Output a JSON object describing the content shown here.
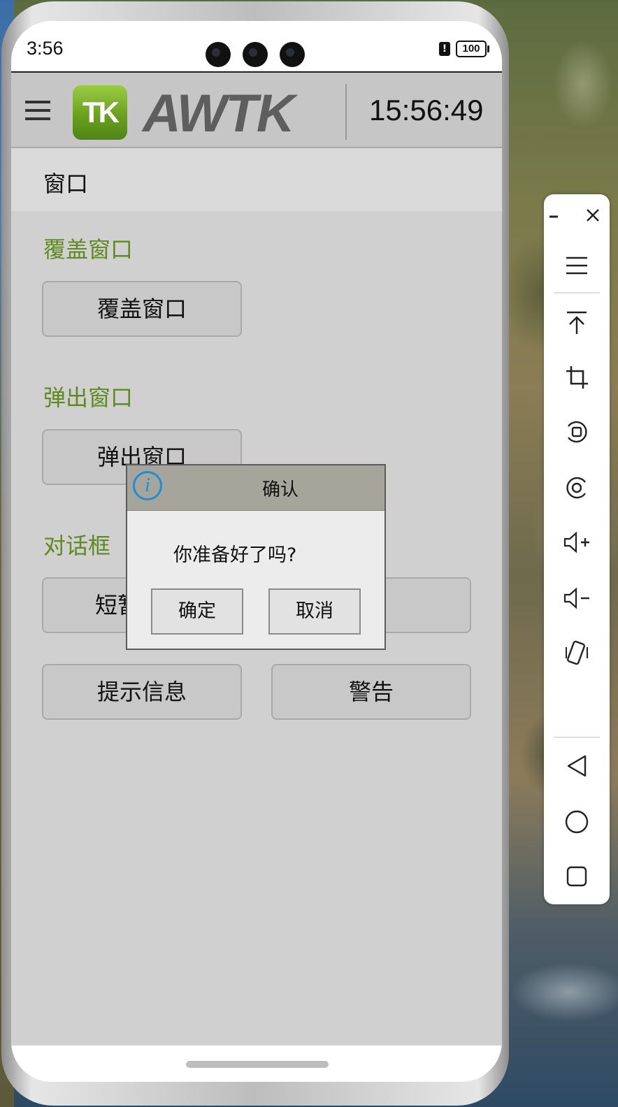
{
  "status_bar": {
    "time": "3:56",
    "alert": "!",
    "battery": "100"
  },
  "header": {
    "logo_badge": "TK",
    "logo_text": "AWTK",
    "clock": "15:56:49"
  },
  "page": {
    "title": "窗口"
  },
  "sections": {
    "overlay": {
      "title": "覆盖窗口",
      "button": "覆盖窗口"
    },
    "popup": {
      "title": "弹出窗口",
      "button": "弹出窗口"
    },
    "dialog": {
      "title": "对话框",
      "button_short": "短暂",
      "button_confirm_partial": "认",
      "button_info": "提示信息",
      "button_warn": "警告"
    }
  },
  "confirm_dialog": {
    "title": "确认",
    "icon": "i",
    "message": "你准备好了吗?",
    "ok_label": "确定",
    "cancel_label": "取消"
  },
  "colors": {
    "section_title": "#5f8a1f",
    "info_icon": "#1e8ed8"
  },
  "side_toolbar": {
    "items": [
      "minimize-icon",
      "close-icon",
      "menu-icon",
      "pin-top-icon",
      "crop-icon",
      "screenshot-icon",
      "screen-record-icon",
      "volume-up-icon",
      "volume-down-icon",
      "rotate-icon",
      "back-icon",
      "home-icon",
      "recents-icon"
    ]
  }
}
